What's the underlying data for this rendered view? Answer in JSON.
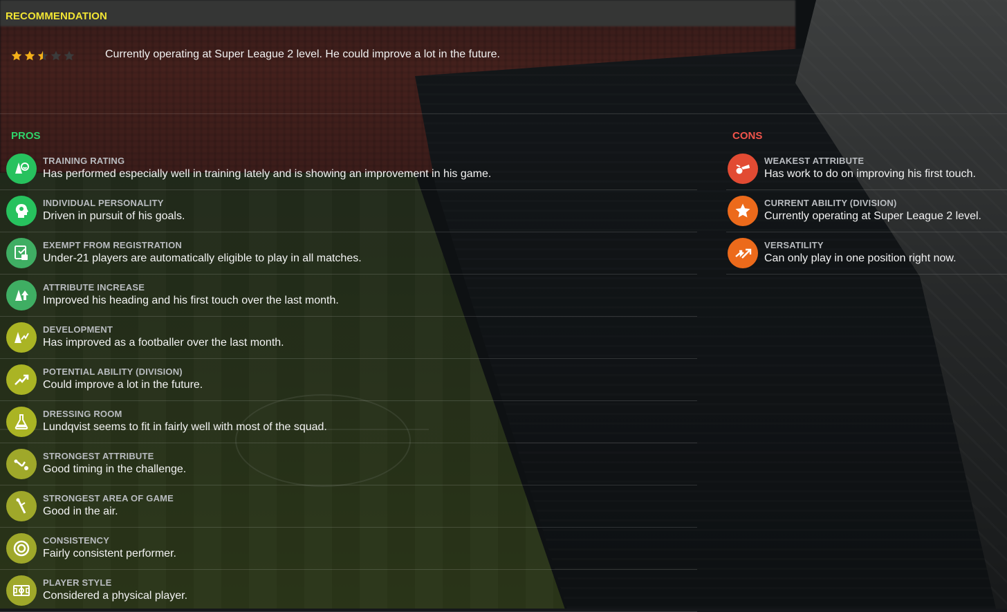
{
  "recommendation": {
    "title": "RECOMMENDATION",
    "stars": 2.5,
    "stars_max": 5,
    "text": "Currently operating at Super League 2 level. He could improve a lot in the future."
  },
  "pros": {
    "title": "PROS",
    "items": [
      {
        "label": "TRAINING RATING",
        "text": "Has performed especially well in training lately and is showing an improvement in his game.",
        "icon": "training-icon"
      },
      {
        "label": "INDIVIDUAL PERSONALITY",
        "text": "Driven in pursuit of his goals.",
        "icon": "personality-head-icon"
      },
      {
        "label": "EXEMPT FROM REGISTRATION",
        "text": "Under-21 players are automatically eligible to play in all matches.",
        "icon": "registration-icon"
      },
      {
        "label": "ATTRIBUTE INCREASE",
        "text": "Improved his heading and his first touch over the last month.",
        "icon": "attribute-increase-icon"
      },
      {
        "label": "DEVELOPMENT",
        "text": "Has improved as a footballer over the last month.",
        "icon": "development-icon"
      },
      {
        "label": "POTENTIAL ABILITY (DIVISION)",
        "text": "Could improve a lot in the future.",
        "icon": "trend-up-icon"
      },
      {
        "label": "DRESSING ROOM",
        "text": "Lundqvist seems to fit in fairly well with most of the squad.",
        "icon": "flask-icon"
      },
      {
        "label": "STRONGEST ATTRIBUTE",
        "text": "Good timing in the challenge.",
        "icon": "tackle-icon"
      },
      {
        "label": "STRONGEST AREA OF GAME",
        "text": "Good in the air.",
        "icon": "header-icon"
      },
      {
        "label": "CONSISTENCY",
        "text": "Fairly consistent performer.",
        "icon": "target-icon"
      },
      {
        "label": "PLAYER STYLE",
        "text": "Considered a physical player.",
        "icon": "pitch-icon"
      }
    ]
  },
  "cons": {
    "title": "CONS",
    "items": [
      {
        "label": "WEAKEST ATTRIBUTE",
        "text": "Has work to do on improving his first touch.",
        "icon": "first-touch-icon"
      },
      {
        "label": "CURRENT ABILITY (DIVISION)",
        "text": "Currently operating at Super League 2 level.",
        "icon": "star-icon"
      },
      {
        "label": "VERSATILITY",
        "text": "Can only play in one position right now.",
        "icon": "versatility-arrows-icon"
      }
    ]
  },
  "colors": {
    "recommendation_title": "#f2e534",
    "pros_title": "#2fd56a",
    "cons_title": "#f2544b",
    "star_filled": "#f4b019",
    "star_empty": "#3b3b3b"
  }
}
